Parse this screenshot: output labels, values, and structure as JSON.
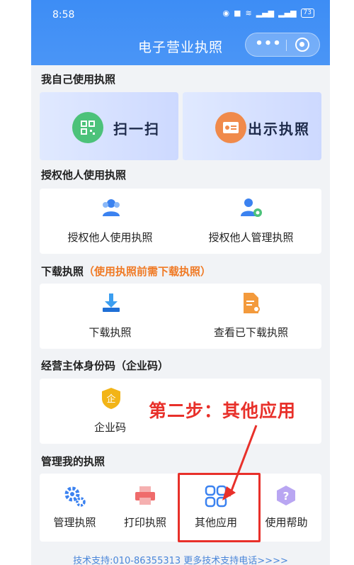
{
  "status_bar": {
    "time": "8:58",
    "battery": "73"
  },
  "header": {
    "title": "电子营业执照",
    "more_icon": "more-dots-icon",
    "close_icon": "target-close-icon"
  },
  "sections": {
    "self_use": {
      "title": "我自己使用执照",
      "buttons": [
        {
          "label": "扫一扫",
          "icon": "qr-scan-icon",
          "icon_color": "#4cc27a"
        },
        {
          "label": "出示执照",
          "icon": "license-card-icon",
          "icon_color": "#f08a4b"
        }
      ]
    },
    "authorize": {
      "title": "授权他人使用执照",
      "items": [
        {
          "label": "授权他人使用执照",
          "icon": "users-icon"
        },
        {
          "label": "授权他人管理执照",
          "icon": "user-gear-icon"
        }
      ]
    },
    "download": {
      "title": "下载执照",
      "note": "（使用执照前需下载执照）",
      "items": [
        {
          "label": "下载执照",
          "icon": "download-tray-icon"
        },
        {
          "label": "查看已下载执照",
          "icon": "document-search-icon"
        }
      ]
    },
    "entity_code": {
      "title": "经营主体身份码（企业码）",
      "items": [
        {
          "label": "企业码",
          "icon": "shield-badge-icon",
          "badge_text": "企"
        }
      ]
    },
    "manage": {
      "title": "管理我的执照",
      "items": [
        {
          "label": "管理执照",
          "icon": "gears-icon"
        },
        {
          "label": "打印执照",
          "icon": "printer-icon"
        },
        {
          "label": "其他应用",
          "icon": "apps-grid-icon"
        },
        {
          "label": "使用帮助",
          "icon": "help-icon"
        }
      ]
    }
  },
  "annotation": {
    "text": "第二步：其他应用",
    "color": "#e8302a"
  },
  "footer": {
    "text": "技术支持:010-86355313  更多技术支持电话>>>>"
  },
  "colors": {
    "header": "#3d8df5",
    "accent_blue": "#3b82f0",
    "note_orange": "#f07a25"
  }
}
